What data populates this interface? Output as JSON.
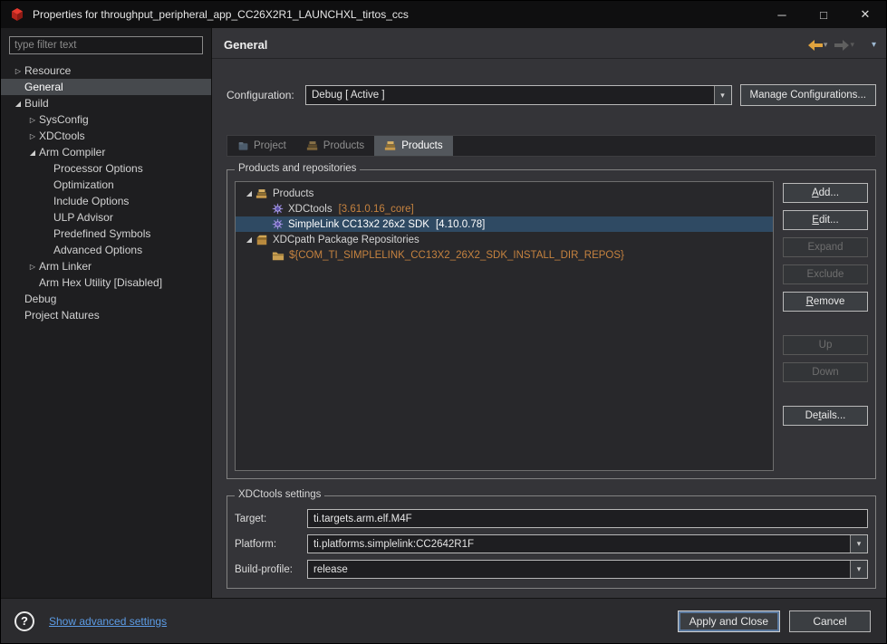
{
  "window": {
    "title": "Properties for throughput_peripheral_app_CC26X2R1_LAUNCHXL_tirtos_ccs",
    "controls": {
      "minimize": "─",
      "maximize": "□",
      "close": "✕"
    }
  },
  "sidebar": {
    "filter_placeholder": "type filter text",
    "tree": [
      {
        "label": "Resource",
        "indent": 0,
        "arrow": "collapsed"
      },
      {
        "label": "General",
        "indent": 0,
        "selected": true
      },
      {
        "label": "Build",
        "indent": 0,
        "arrow": "expanded"
      },
      {
        "label": "SysConfig",
        "indent": 1,
        "arrow": "collapsed"
      },
      {
        "label": "XDCtools",
        "indent": 1,
        "arrow": "collapsed"
      },
      {
        "label": "Arm Compiler",
        "indent": 1,
        "arrow": "expanded"
      },
      {
        "label": "Processor Options",
        "indent": 2
      },
      {
        "label": "Optimization",
        "indent": 2
      },
      {
        "label": "Include Options",
        "indent": 2
      },
      {
        "label": "ULP Advisor",
        "indent": 2
      },
      {
        "label": "Predefined Symbols",
        "indent": 2
      },
      {
        "label": "Advanced Options",
        "indent": 2
      },
      {
        "label": "Arm Linker",
        "indent": 1,
        "arrow": "collapsed"
      },
      {
        "label": "Arm Hex Utility  [Disabled]",
        "indent": 1
      },
      {
        "label": "Debug",
        "indent": 0
      },
      {
        "label": "Project Natures",
        "indent": 0
      }
    ]
  },
  "header": {
    "title": "General"
  },
  "configuration": {
    "label": "Configuration:",
    "value": "Debug  [ Active ]",
    "manage_button": "Manage Configurations..."
  },
  "tabs": [
    {
      "label": "Project",
      "icon": "project-icon",
      "active": false
    },
    {
      "label": "Products",
      "icon": "products-stack-icon",
      "active": false
    },
    {
      "label": "Products",
      "icon": "products-stack-icon",
      "active": true
    }
  ],
  "products_group": {
    "title": "Products and repositories",
    "rows": [
      {
        "indent": 0,
        "arrow": "expanded",
        "icon": "products-stack-icon",
        "text": "Products"
      },
      {
        "indent": 1,
        "icon": "xdc-gear-icon",
        "text": "XDCtools",
        "suffix": "[3.61.0.16_core]"
      },
      {
        "indent": 1,
        "icon": "xdc-gear-icon",
        "text": "SimpleLink CC13x2 26x2 SDK",
        "suffix": "[4.10.0.78]",
        "selected": true
      },
      {
        "indent": 0,
        "arrow": "expanded",
        "icon": "package-icon",
        "text": "XDCpath Package Repositories"
      },
      {
        "indent": 1,
        "icon": "folder-repo-icon",
        "text": "${COM_TI_SIMPLELINK_CC13X2_26X2_SDK_INSTALL_DIR_REPOS}",
        "orange": true
      }
    ],
    "buttons": [
      {
        "label": "Add...",
        "enabled": true,
        "mnemonic": 0
      },
      {
        "label": "Edit...",
        "enabled": true,
        "mnemonic": 0
      },
      {
        "label": "Expand",
        "enabled": false
      },
      {
        "label": "Exclude",
        "enabled": false
      },
      {
        "label": "Remove",
        "enabled": true,
        "mnemonic": 0
      },
      {
        "label": "Up",
        "enabled": false,
        "gap_before": true
      },
      {
        "label": "Down",
        "enabled": false
      },
      {
        "label": "Details...",
        "enabled": true,
        "mnemonic": 2,
        "gap_before": true
      }
    ]
  },
  "xdctools_group": {
    "title": "XDCtools settings",
    "fields": [
      {
        "label": "Target:",
        "value": "ti.targets.arm.elf.M4F",
        "type": "text"
      },
      {
        "label": "Platform:",
        "value": "ti.platforms.simplelink:CC2642R1F",
        "type": "combo"
      },
      {
        "label": "Build-profile:",
        "value": "release",
        "type": "combo"
      }
    ]
  },
  "footer": {
    "link": "Show advanced settings",
    "apply_button": "Apply and Close",
    "cancel_button": "Cancel"
  },
  "colors": {
    "accent_orange": "#c5823f",
    "link_blue": "#5c9ce6",
    "selection_blue": "#2f4a63",
    "back_arrow_gold": "#e0a33e"
  }
}
